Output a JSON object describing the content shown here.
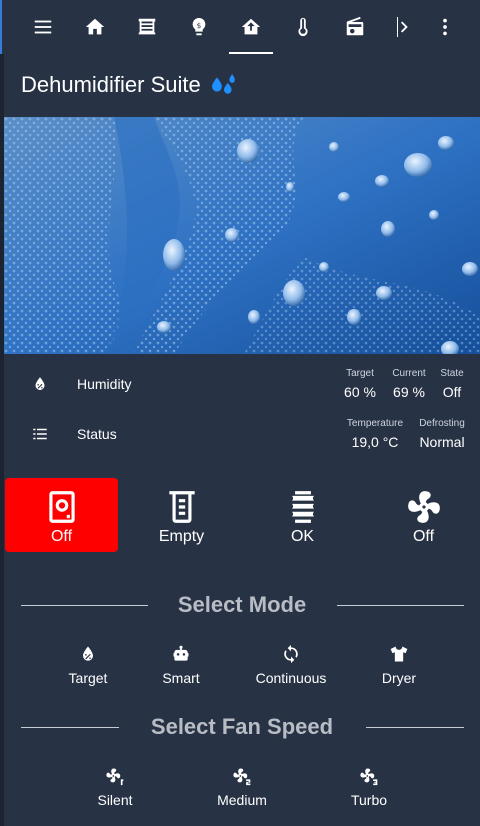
{
  "topbar": {
    "icons": [
      "menu-icon",
      "home-icon",
      "blinds-icon",
      "lightbulb-icon",
      "home-export-icon",
      "thermometer-icon",
      "radio-icon",
      "chevron-right-icon",
      "more-vertical-icon"
    ]
  },
  "header": {
    "title": "Dehumidifier Suite",
    "title_icon": "water-drops-icon",
    "title_icon_color": "#1e90ff"
  },
  "info": {
    "humidity": {
      "label": "Humidity",
      "target_key": "Target",
      "target_val": "60 %",
      "current_key": "Current",
      "current_val": "69 %",
      "state_key": "State",
      "state_val": "Off"
    },
    "status": {
      "label": "Status",
      "temperature_key": "Temperature",
      "temperature_val": "19,0 °C",
      "defrosting_key": "Defrosting",
      "defrosting_val": "Normal"
    }
  },
  "tiles": [
    {
      "label": "Off",
      "icon": "dehumidifier-icon",
      "color": "#ff0000"
    },
    {
      "label": "Empty",
      "icon": "beaker-icon",
      "color": "#283245"
    },
    {
      "label": "OK",
      "icon": "filter-icon",
      "color": "#283245"
    },
    {
      "label": "Off",
      "icon": "fan-icon",
      "color": "#283245"
    }
  ],
  "mode": {
    "title": "Select Mode",
    "options": [
      {
        "label": "Target",
        "icon": "water-percent-icon"
      },
      {
        "label": "Smart",
        "icon": "robot-icon"
      },
      {
        "label": "Continuous",
        "icon": "sync-icon"
      },
      {
        "label": "Dryer",
        "icon": "tshirt-icon"
      }
    ]
  },
  "fan": {
    "title": "Select Fan Speed",
    "options": [
      {
        "label": "Silent",
        "icon": "fan-speed-1-icon"
      },
      {
        "label": "Medium",
        "icon": "fan-speed-2-icon"
      },
      {
        "label": "Turbo",
        "icon": "fan-speed-3-icon"
      }
    ]
  },
  "colors": {
    "background": "#1c2331",
    "card": "#283245",
    "accent_red": "#ff0000",
    "divider": "#c6cbd4"
  }
}
